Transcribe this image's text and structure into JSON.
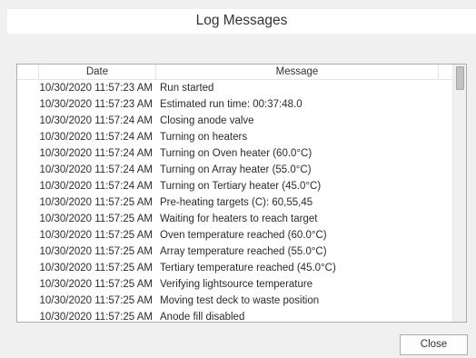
{
  "window": {
    "title": "Log Messages"
  },
  "log": {
    "columns": {
      "date": "Date",
      "message": "Message"
    },
    "rows": [
      {
        "date": "10/30/2020 11:57:23 AM",
        "message": "Run started"
      },
      {
        "date": "10/30/2020 11:57:23 AM",
        "message": "Estimated run time: 00:37:48.0"
      },
      {
        "date": "10/30/2020 11:57:24 AM",
        "message": "Closing anode valve"
      },
      {
        "date": "10/30/2020 11:57:24 AM",
        "message": "Turning on heaters"
      },
      {
        "date": "10/30/2020 11:57:24 AM",
        "message": "Turning on Oven heater (60.0°C)"
      },
      {
        "date": "10/30/2020 11:57:24 AM",
        "message": "Turning on Array heater (55.0°C)"
      },
      {
        "date": "10/30/2020 11:57:24 AM",
        "message": "Turning on Tertiary heater (45.0°C)"
      },
      {
        "date": "10/30/2020 11:57:25 AM",
        "message": "Pre-heating targets (C): 60,55,45"
      },
      {
        "date": "10/30/2020 11:57:25 AM",
        "message": "Waiting for heaters to reach target"
      },
      {
        "date": "10/30/2020 11:57:25 AM",
        "message": "Oven temperature reached (60.0°C)"
      },
      {
        "date": "10/30/2020 11:57:25 AM",
        "message": "Array temperature reached (55.0°C)"
      },
      {
        "date": "10/30/2020 11:57:25 AM",
        "message": "Tertiary temperature reached (45.0°C)"
      },
      {
        "date": "10/30/2020 11:57:25 AM",
        "message": "Verifying lightsource temperature"
      },
      {
        "date": "10/30/2020 11:57:25 AM",
        "message": "Moving test deck to waste position"
      },
      {
        "date": "10/30/2020 11:57:25 AM",
        "message": "Anode fill disabled"
      }
    ]
  },
  "buttons": {
    "close_label": "Close"
  }
}
